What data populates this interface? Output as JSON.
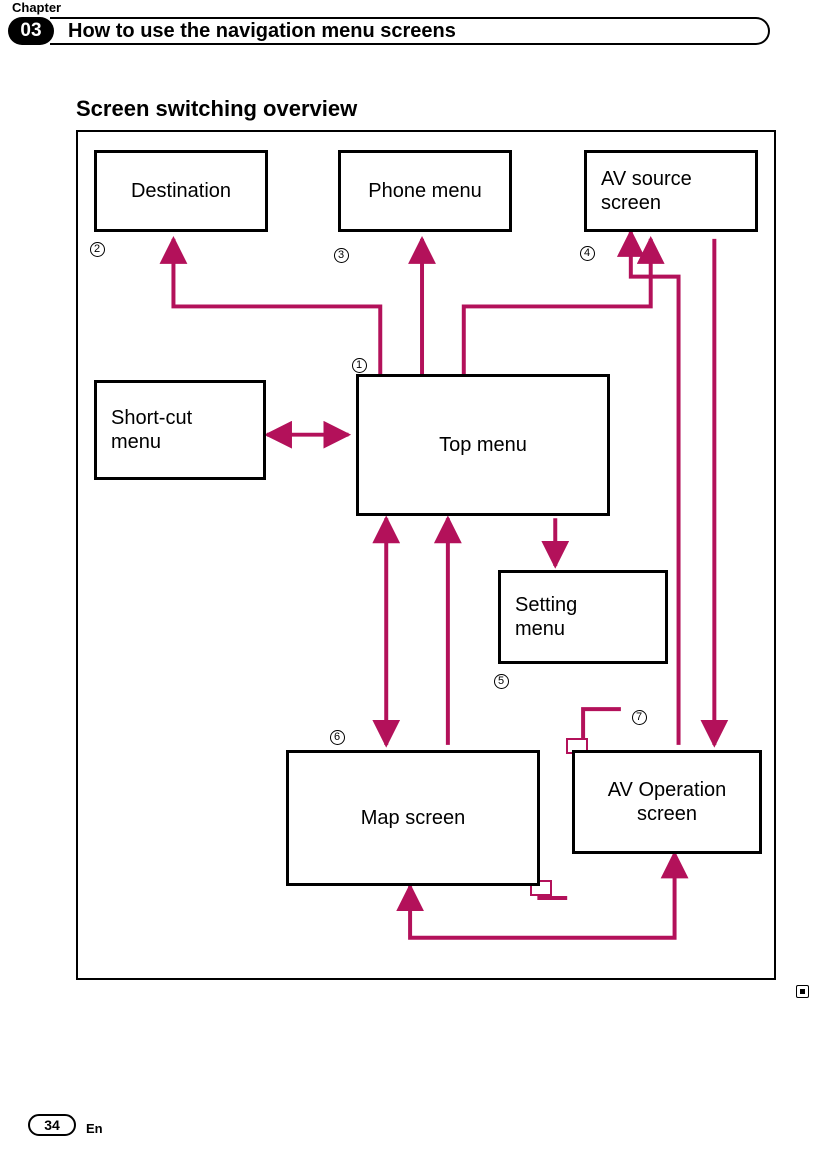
{
  "header": {
    "chapter_label": "Chapter",
    "chapter_num": "03",
    "title": "How to use the navigation menu screens"
  },
  "section_heading": "Screen switching overview",
  "boxes": {
    "destination": "Destination",
    "phone_menu": "Phone menu",
    "av_source": "AV source\nscreen",
    "shortcut": "Short-cut\nmenu",
    "top_menu": "Top menu",
    "setting_menu": "Setting\nmenu",
    "map_screen": "Map screen",
    "av_op": "AV Operation\nscreen"
  },
  "callouts": {
    "c1": "1",
    "c2": "2",
    "c3": "3",
    "c4": "4",
    "c5": "5",
    "c6": "6",
    "c7": "7"
  },
  "footer": {
    "page": "34",
    "lang": "En"
  },
  "colors": {
    "arrow": "#b3115a"
  }
}
